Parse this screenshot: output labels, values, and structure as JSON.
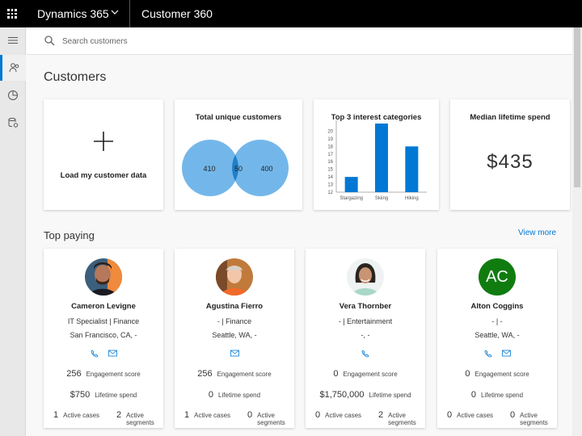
{
  "topbar": {
    "app_name": "Dynamics 365",
    "area_name": "Customer 360"
  },
  "search": {
    "placeholder": "Search customers"
  },
  "page": {
    "title": "Customers",
    "top_paying_title": "Top paying",
    "view_more": "View more"
  },
  "tiles": {
    "load": {
      "label": "Load my customer data"
    },
    "unique": {
      "title": "Total unique customers",
      "left": "410",
      "overlap": "50",
      "right": "400"
    },
    "interests": {
      "title": "Top 3 interest categories"
    },
    "median": {
      "title": "Median lifetime spend",
      "value": "$435"
    }
  },
  "chart_data": {
    "type": "bar",
    "title": "Top 3 interest categories",
    "categories": [
      "Stargazing",
      "Skiing",
      "Hiking"
    ],
    "values": [
      14,
      21,
      18
    ],
    "ylim": [
      12,
      21
    ],
    "yticks": [
      12,
      13,
      14,
      15,
      16,
      17,
      18,
      19,
      20
    ],
    "color": "#0078d4"
  },
  "customers": [
    {
      "name": "Cameron Levigne",
      "line1": "IT Specialist | Finance",
      "line2": "San Francisco, CA, -",
      "engagement": "256",
      "spend": "$750",
      "cases": "1",
      "segments": "2"
    },
    {
      "name": "Agustina Fierro",
      "line1": "- | Finance",
      "line2": "Seattle, WA, -",
      "engagement": "256",
      "spend": "0",
      "cases": "1",
      "segments": "0"
    },
    {
      "name": "Vera Thornber",
      "line1": "- | Entertainment",
      "line2": "-, -",
      "engagement": "0",
      "spend": "$1,750,000",
      "cases": "0",
      "segments": "2"
    },
    {
      "name": "Alton Coggins",
      "initials": "AC",
      "line1": "- | -",
      "line2": "Seattle, WA, -",
      "engagement": "0",
      "spend": "0",
      "cases": "0",
      "segments": "0"
    }
  ],
  "labels": {
    "engagement": "Engagement score",
    "spend": "Lifetime spend",
    "cases": "Active cases",
    "segments_1": "Active",
    "segments_2": "segments"
  },
  "colors": {
    "accent": "#0078d4",
    "venn": "#5aaae6",
    "initials_bg": "#107c10"
  }
}
